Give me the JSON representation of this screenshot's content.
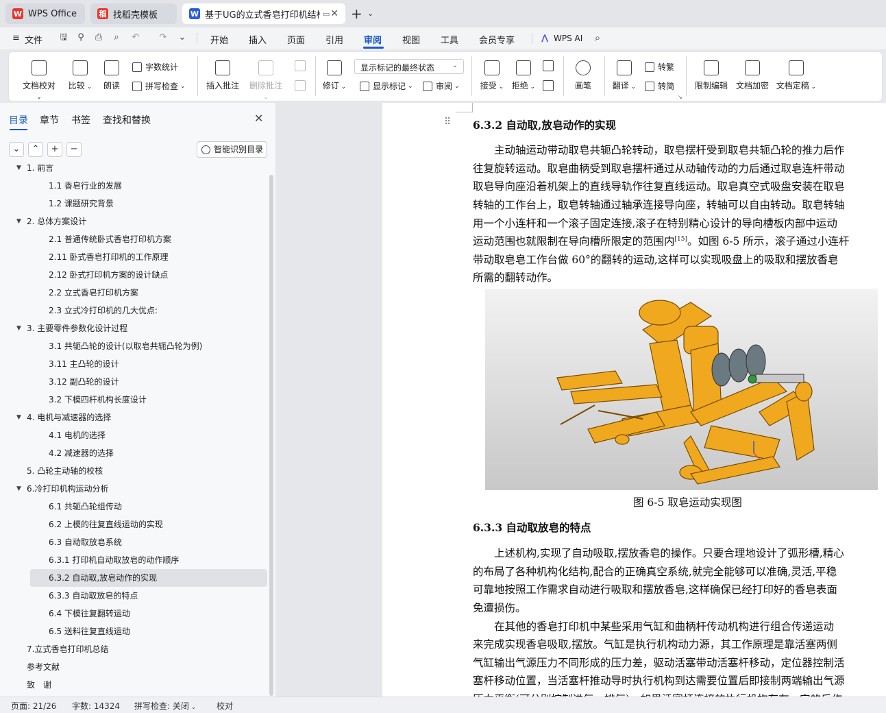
{
  "tabs": [
    {
      "label": "WPS Office",
      "color": "#e8372b"
    },
    {
      "label": "找稻壳模板",
      "color": "#e8372b"
    },
    {
      "label": "基于UG的立式香皂打印机结构",
      "color": "#2b5fd9"
    }
  ],
  "menu": {
    "file": "文件",
    "items": [
      "开始",
      "插入",
      "页面",
      "引用",
      "审阅",
      "视图",
      "工具",
      "会员专享"
    ],
    "active": "审阅",
    "wps_ai": "WPS AI"
  },
  "ribbon": {
    "doc_compare": "文档校对",
    "compare": "比较",
    "read_aloud": "朗读",
    "word_count": "字数统计",
    "spell_check": "拼写检查",
    "insert_comment": "插入批注",
    "delete_comment": "删除批注",
    "revise": "修订",
    "markup_state": "显示标记的最终状态",
    "show_markup": "显示标记",
    "review": "审阅",
    "accept": "接受",
    "reject": "拒绝",
    "pen": "画笔",
    "translate": "翻译",
    "to_traditional": "转繁",
    "to_simplified": "转简",
    "restrict_edit": "限制编辑",
    "encrypt": "文档加密",
    "finalize": "文档定稿"
  },
  "sidebar": {
    "tabs": [
      "目录",
      "章节",
      "书签",
      "查找和替换"
    ],
    "smart_toc": "智能识别目录",
    "toc": [
      {
        "label": "1. 前言",
        "level": 1,
        "caret": true
      },
      {
        "label": "1.1 香皂行业的发展",
        "level": 2
      },
      {
        "label": "1.2 课题研究背景",
        "level": 2
      },
      {
        "label": "2. 总体方案设计",
        "level": 1,
        "caret": true
      },
      {
        "label": "2.1 普通传统卧式香皂打印机方案",
        "level": 2
      },
      {
        "label": "2.11 卧式香皂打印机的工作原理",
        "level": 2
      },
      {
        "label": "2.12 卧式打印机方案的设计缺点",
        "level": 2
      },
      {
        "label": "2.2 立式香皂打印机方案",
        "level": 2
      },
      {
        "label": "2.3 立式冷打印机的几大优点:",
        "level": 2
      },
      {
        "label": "3. 主要零件参数化设计过程",
        "level": 1,
        "caret": true
      },
      {
        "label": "3.1 共轭凸轮的设计(以取皂共轭凸轮为例)",
        "level": 2
      },
      {
        "label": "3.11 主凸轮的设计",
        "level": 2
      },
      {
        "label": "3.12 副凸轮的设计",
        "level": 2
      },
      {
        "label": "3.2 下模四杆机构长度设计",
        "level": 2
      },
      {
        "label": "4. 电机与减速器的选择",
        "level": 1,
        "caret": true
      },
      {
        "label": "4.1 电机的选择",
        "level": 2
      },
      {
        "label": "4.2 减速器的选择",
        "level": 2
      },
      {
        "label": "5. 凸轮主动轴的校核",
        "level": 1
      },
      {
        "label": "6.冷打印机构运动分析",
        "level": 1,
        "caret": true
      },
      {
        "label": "6.1 共轭凸轮组传动",
        "level": 2
      },
      {
        "label": "6.2 上模的往复直线运动的实现",
        "level": 2
      },
      {
        "label": "6.3 自动取放皂系统",
        "level": 2
      },
      {
        "label": "6.3.1 打印机自动取放皂的动作顺序",
        "level": 2
      },
      {
        "label": "6.3.2 自动取,放皂动作的实现",
        "level": 2,
        "selected": true
      },
      {
        "label": "6.3.3 自动取放皂的特点",
        "level": 2
      },
      {
        "label": "6.4 下模往复翻转运动",
        "level": 2
      },
      {
        "label": "6.5 送料往复直线运动",
        "level": 2
      },
      {
        "label": "7.立式香皂打印机总结",
        "level": 1
      },
      {
        "label": "参考文献",
        "level": 1
      },
      {
        "label": "致　谢",
        "level": 1
      }
    ]
  },
  "document": {
    "heading1": "6.3.2 自动取,放皂动作的实现",
    "para1": [
      "　　主动轴运动带动取皂共轭凸轮转动，取皂摆杆受到取皂共轭凸轮的推力后作",
      "往复旋转运动。取皂曲柄受到取皂摆杆通过从动轴传动的力后通过取皂连杆带动",
      "取皂导向座沿着机架上的直线导轨作往复直线运动。取皂真空式吸盘安装在取皂",
      "转轴的工作台上，取皂转轴通过轴承连接导向座，转轴可以自由转动。取皂转轴",
      "用一个小连杆和一个滚子固定连接,滚子在特别精心设计的导向槽板内部中运动",
      "运动范围也就限制在导向槽所限定的范围内",
      "带动取皂皂工作台做 60°的翻转的运动,这样可以实现吸盘上的吸取和摆放香皂",
      "所需的翻转动作。"
    ],
    "ref_mark": "[15]",
    "para1_line6_tail": "。如图 6-5 所示，滚子通过小连杆",
    "figure_caption": "图 6-5  取皂运动实现图",
    "heading2": "6.3.3 自动取放皂的特点",
    "para2": [
      "　　上述机构,实现了自动吸取,摆放香皂的操作。只要合理地设计了弧形槽,精心",
      "的布局了各种机构化结构,配合的正确真空系统,就完全能够可以准确,灵活,平稳",
      "可靠地按照工作需求自动进行吸取和摆放香皂,这样确保已经打印好的香皂表面",
      "免遭损伤。"
    ],
    "para3": [
      "　　在其他的香皂打印机中某些采用气缸和曲柄杆传动机构进行组合传递运动",
      "来完成实现香皂吸取,摆放。气缸是执行机构动力源，其工作原理是靠活塞两侧",
      "气缸输出气源压力不同形成的压力差，驱动活塞带动活塞杆移动，定位器控制活",
      "塞杆移动位置，当活塞杆推动导时执行机构到达需要位置后即接制两端输出气源",
      "压力平衡(可分别控制进气、排气)，如果活塞杆连接的执行机构存在一定的反作"
    ]
  },
  "status": {
    "page": "页面: 21/26",
    "words": "字数: 14324",
    "spell": "拼写检查: 关闭",
    "proof": "校对"
  }
}
